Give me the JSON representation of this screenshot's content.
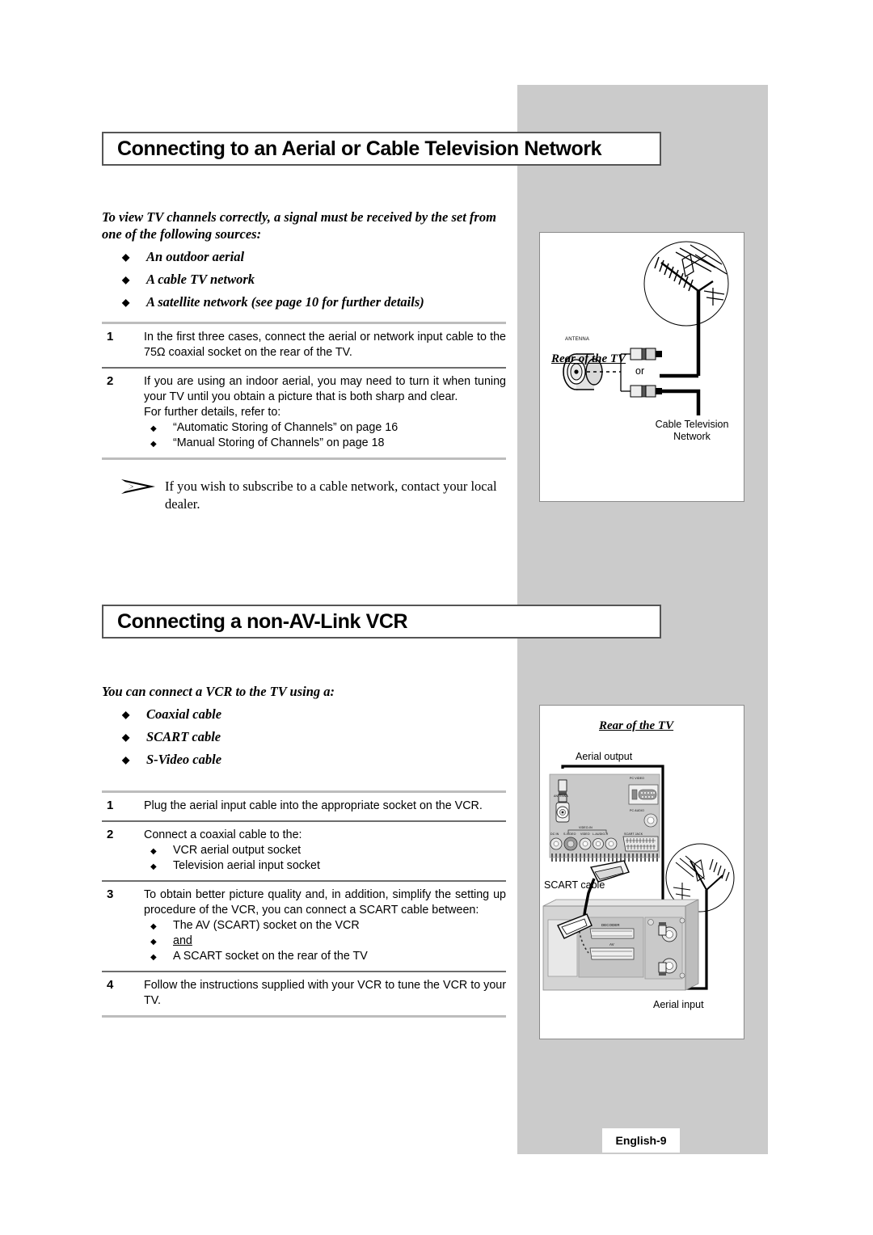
{
  "page": {
    "footer_label": "English-9",
    "background_color": "#cbcbcb"
  },
  "section_1": {
    "heading": "Connecting to an Aerial or Cable Television Network",
    "intro": "To view TV channels correctly, a signal must be received by the set from one of the following sources:",
    "bullets": [
      "An outdoor aerial",
      "A cable TV network",
      "A satellite network (see page 10 for further details)"
    ],
    "steps": [
      {
        "number": "1",
        "text": "In the first three cases, connect the aerial or network input cable to the 75Ω coaxial socket on the rear of the TV.",
        "sub": []
      },
      {
        "number": "2",
        "text": "If you are using an indoor aerial, you may need to turn it when tuning your TV until you obtain a picture that is both sharp and clear.",
        "text2": "For further details, refer to:",
        "sub": [
          "“Automatic Storing of Channels” on page 16",
          "“Manual Storing of Channels” on page 18"
        ]
      }
    ],
    "note": "If you wish to subscribe to a cable network, contact your local dealer."
  },
  "section_2": {
    "heading": "Connecting a non-AV-Link VCR",
    "intro": "You can connect a VCR to the TV using a:",
    "bullets": [
      "Coaxial cable",
      "SCART cable",
      "S-Video cable"
    ],
    "steps": [
      {
        "number": "1",
        "text": "Plug the aerial input cable into the appropriate socket on the VCR.",
        "sub": []
      },
      {
        "number": "2",
        "text": "Connect a coaxial cable to the:",
        "sub": [
          "VCR aerial output socket",
          "Television aerial input socket"
        ]
      },
      {
        "number": "3",
        "text": "To obtain better picture quality and, in addition, simplify the setting up procedure of the VCR, you can connect a SCART cable between:",
        "sub": [
          "The AV (SCART) socket on the VCR",
          "A SCART socket on the rear of the TV"
        ],
        "conjunction": "and"
      },
      {
        "number": "4",
        "text": "Follow the instructions supplied with your VCR to tune the VCR to your TV.",
        "sub": []
      }
    ]
  },
  "diagram_1": {
    "title": "Rear of the TV",
    "socket_label": "ANTENNA",
    "or_label": "or",
    "source_label_line1": "Cable Television",
    "source_label_line2": "Network"
  },
  "diagram_2": {
    "title": "Rear of the TV",
    "aerial_output_label": "Aerial output",
    "aerial_input_label": "Aerial input",
    "scart_cable_label": "SCART cable",
    "tv_panel": {
      "antenna": "ANTENNA",
      "pc_video": "PC VIDEO",
      "pc_audio": "PC AUDIO",
      "video_in": "VIDEO-IN",
      "dc_in": "DC IN",
      "s_video": "S-VIDEO",
      "video": "VIDEO",
      "l_audio_r": "L-AUDIO-R",
      "scart_jack": "SCART JACK"
    },
    "vcr_panel": {
      "decoder": "DECODER",
      "av": "AV"
    }
  }
}
